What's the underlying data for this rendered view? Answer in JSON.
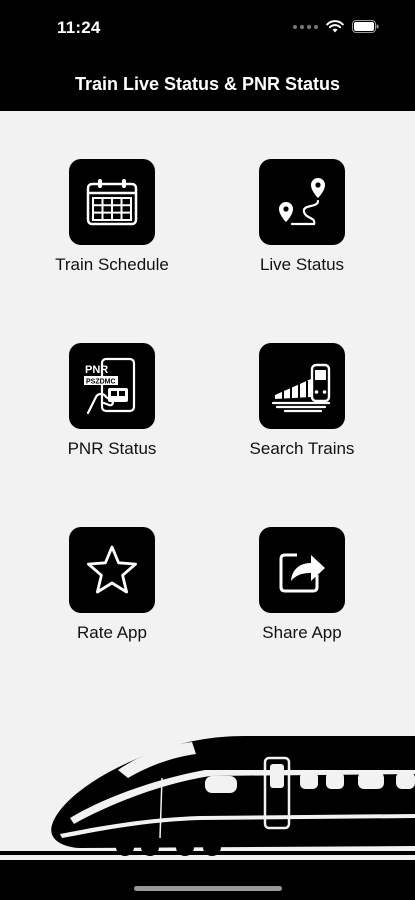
{
  "status_bar": {
    "time": "11:24"
  },
  "header": {
    "title": "Train Live Status & PNR Status"
  },
  "menu": [
    {
      "label": "Train Schedule",
      "icon": "calendar-icon"
    },
    {
      "label": "Live Status",
      "icon": "route-pin-icon"
    },
    {
      "label": "PNR Status",
      "icon": "pnr-ticket-icon",
      "icon_text_1": "PNR",
      "icon_text_2": "PSZDMC"
    },
    {
      "label": "Search Trains",
      "icon": "search-train-icon"
    },
    {
      "label": "Rate App",
      "icon": "star-icon"
    },
    {
      "label": "Share App",
      "icon": "share-icon"
    }
  ],
  "colors": {
    "header_bg": "#000000",
    "body_bg": "#f2f2f2",
    "icon_bg": "#000000",
    "icon_fg": "#ffffff"
  }
}
